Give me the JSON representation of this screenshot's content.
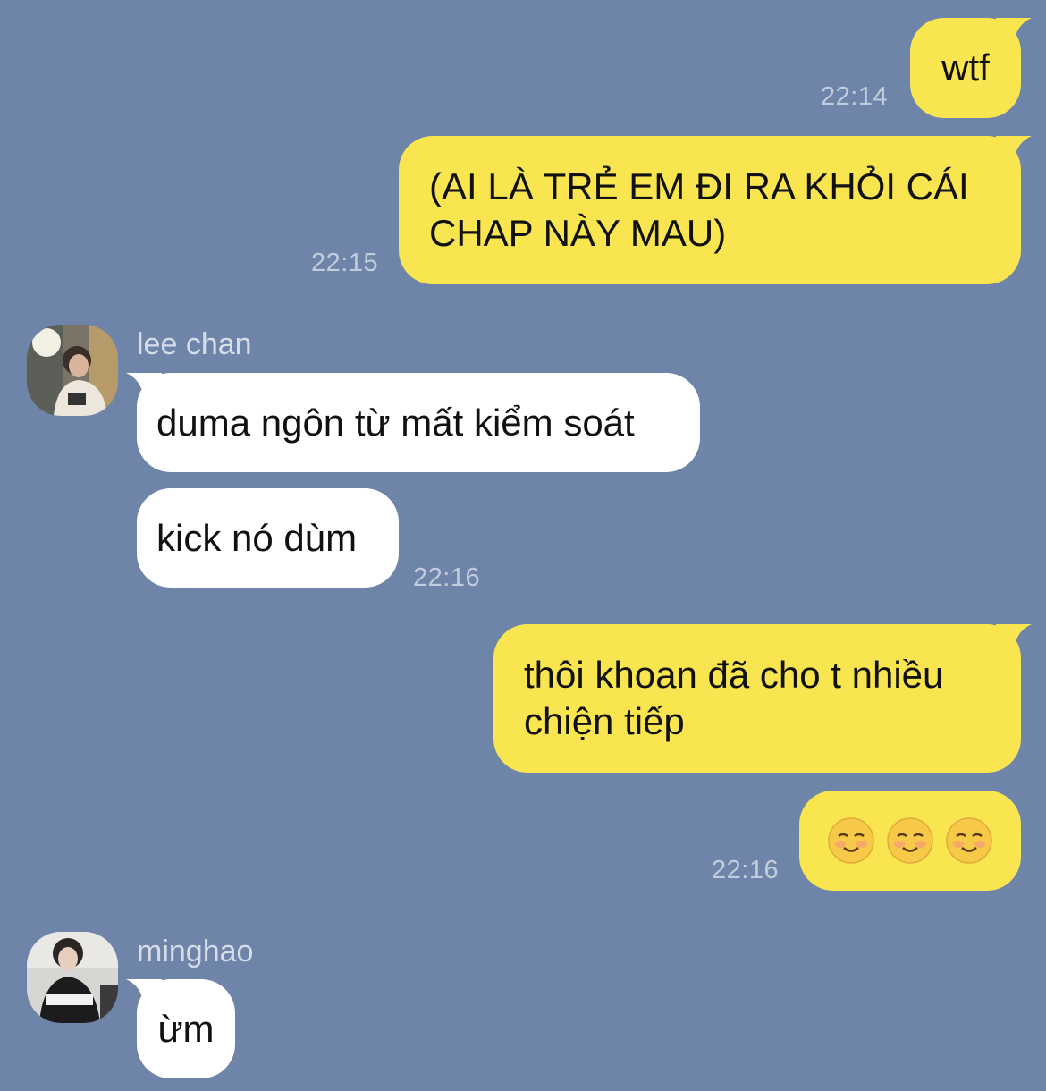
{
  "messages": [
    {
      "sender": "me",
      "text": "wtf",
      "time": "22:14"
    },
    {
      "sender": "me",
      "text": "(AI LÀ TRẺ EM ĐI RA KHỎI CÁI CHAP NÀY MAU)",
      "time": "22:15"
    },
    {
      "sender": "lee chan",
      "text": "duma ngôn từ mất kiểm soát"
    },
    {
      "sender": "lee chan",
      "text": "kick nó dùm",
      "time": "22:16"
    },
    {
      "sender": "me",
      "text": "thôi khoan đã cho t nhiều chiện tiếp"
    },
    {
      "sender": "me",
      "emoji": [
        "smiling-face-icon",
        "smiling-face-icon",
        "smiling-face-icon"
      ],
      "time": "22:16"
    },
    {
      "sender": "minghao",
      "text": "ừm"
    }
  ],
  "names": {
    "lee_chan": "lee chan",
    "minghao": "minghao"
  },
  "colors": {
    "background": "#6e84a9",
    "outgoing": "#f9e54f",
    "incoming": "#ffffff"
  }
}
